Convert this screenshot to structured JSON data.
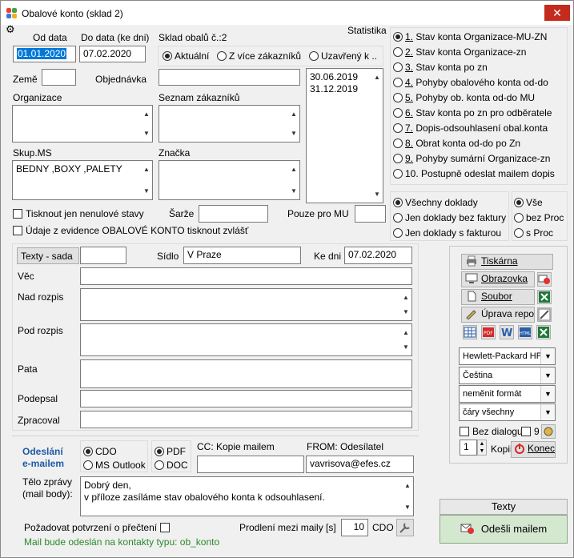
{
  "window": {
    "title": "Obalové konto (sklad 2)",
    "close": "✕"
  },
  "header": {
    "od_data_label": "Od data",
    "od_data_value": "01.01.2020",
    "do_data_label": "Do data (ke dni)",
    "do_data_value": "07.02.2020",
    "sklad_label": "Sklad obalů č.:2",
    "statistika_label": "Statistika"
  },
  "scope_radios": [
    {
      "label": "Aktuální",
      "selected": true
    },
    {
      "label": "Z více zákazníků",
      "selected": false
    },
    {
      "label": "Uzavřený k ..",
      "selected": false
    }
  ],
  "filters": {
    "zeme_label": "Země",
    "zeme_value": "",
    "objednavka_label": "Objednávka",
    "objednavka_value": "",
    "organizace_label": "Organizace",
    "seznam_label": "Seznam zákazníků",
    "skupms_label": "Skup.MS",
    "skupms_value": "BEDNY ,BOXY  ,PALETY",
    "znacka_label": "Značka",
    "dates_list": [
      "30.06.2019",
      "31.12.2019"
    ],
    "nenulove_label": "Tisknout jen nenulové stavy",
    "sarze_label": "Šarže",
    "sarze_value": "",
    "pouze_mu_label": "Pouze pro MU",
    "pouze_mu_value": "",
    "udaje_label": "Údaje z evidence OBALOVÉ KONTO tisknout zvlášť"
  },
  "statistika_options": [
    {
      "num": "1.",
      "label": " Stav konta Organizace-MU-ZN",
      "selected": true
    },
    {
      "num": "2.",
      "label": " Stav konta Organizace-zn",
      "selected": false
    },
    {
      "num": "3.",
      "label": " Stav konta po zn",
      "selected": false
    },
    {
      "num": "4.",
      "label": " Pohyby obalového konta od-do",
      "selected": false
    },
    {
      "num": "5.",
      "label": " Pohyby ob. konta od-do MU",
      "selected": false
    },
    {
      "num": "6.",
      "label": " Stav konta po zn pro odběratele",
      "selected": false
    },
    {
      "num": "7.",
      "label": " Dopis-odsouhlasení obal.konta",
      "selected": false
    },
    {
      "num": "8.",
      "label": " Obrat konta od-do po Zn",
      "selected": false
    },
    {
      "num": "9.",
      "label": " Pohyby sumární Organizace-zn",
      "selected": false
    },
    {
      "num": "",
      "label": "10. Postupně odeslat mailem dopis",
      "selected": false
    }
  ],
  "doklady_options": [
    {
      "label": "Všechny doklady",
      "selected": true
    },
    {
      "label": "Jen doklady bez faktury",
      "selected": false
    },
    {
      "label": "Jen doklady s fakturou",
      "selected": false
    }
  ],
  "proc_options": [
    {
      "label": "Vše",
      "selected": true
    },
    {
      "label": "bez Proc",
      "selected": false
    },
    {
      "label": "s Proc",
      "selected": false
    }
  ],
  "letter": {
    "texty_sada_label": "Texty - sada",
    "texty_sada_value": "",
    "sidlo_label": "Sídlo",
    "sidlo_value": "V Praze",
    "ke_dni_label": "Ke dni",
    "ke_dni_value": "07.02.2020",
    "vec_label": "Věc",
    "nad_rozpis_label": "Nad rozpis",
    "pod_rozpis_label": "Pod rozpis",
    "pata_label": "Pata",
    "podepsal_label": "Podepsal",
    "zpracoval_label": "Zpracoval"
  },
  "email": {
    "odeslani_label_1": "Odeslání",
    "odeslani_label_2": "e-mailem",
    "client_options": [
      {
        "label": "CDO",
        "selected": true
      },
      {
        "label": "MS Outlook",
        "selected": false
      }
    ],
    "format_options": [
      {
        "label": "PDF",
        "selected": true
      },
      {
        "label": "DOC",
        "selected": false
      }
    ],
    "cc_label": "CC: Kopie mailem",
    "cc_value": "",
    "from_label": "FROM: Odesílatel",
    "from_value": "vavrisova@efes.cz",
    "body_label_1": "Tělo zprávy",
    "body_label_2": "(mail body):",
    "body_line_1": "Dobrý den,",
    "body_line_2": "v příloze zasíláme stav obalového konta k odsouhlasení.",
    "potvrzeni_label": "Požadovat potvrzení o přečtení",
    "prodleni_label": "Prodlení mezi maily [s]",
    "prodleni_value": "10",
    "cdo_label": "CDO",
    "kontakty_note": "Mail bude odeslán na kontakty typu: ob_konto"
  },
  "output": {
    "tiskarna": "Tiskárna",
    "obrazovka": "Obrazovka",
    "soubor": "Soubor",
    "uprava": "Úprava repor",
    "printer": "Hewlett-Packard HP",
    "language": "Čeština",
    "format": "neměnit formát",
    "lines": "čáry všechny",
    "bez_dialogu": "Bez dialogu",
    "nine": "9",
    "copies": "1",
    "kopii": "Kopii",
    "konec": "Konec"
  },
  "send": {
    "texty_label": "Texty",
    "odesli_label": "Odešli mailem"
  },
  "colors": {
    "accent": "#0078d7",
    "close": "#c42b1c",
    "mail_note": "#2a8a2a",
    "email_heading": "#1e5aa8"
  }
}
